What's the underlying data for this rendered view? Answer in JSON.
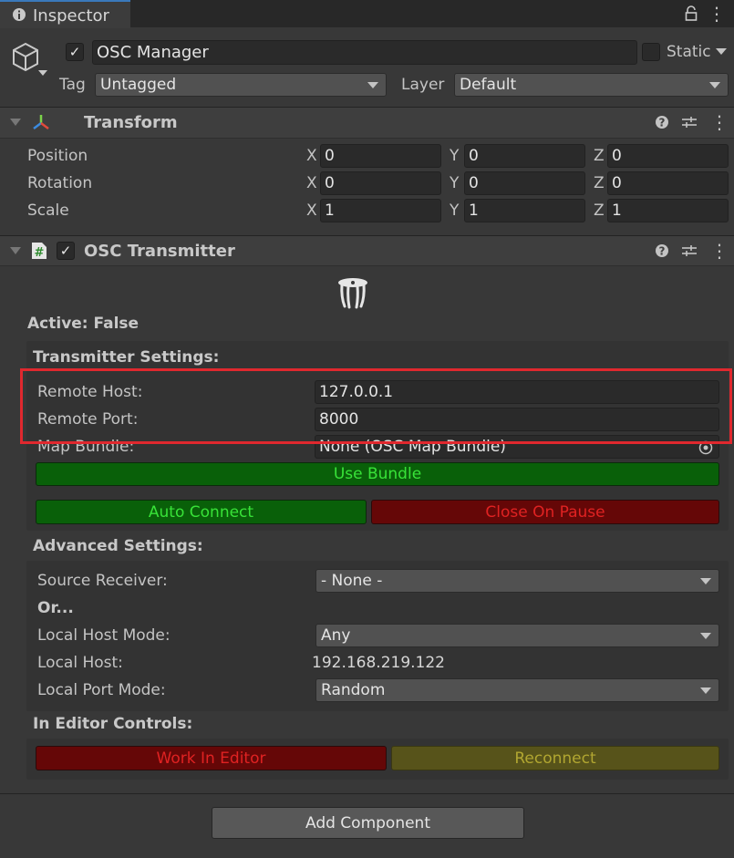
{
  "window": {
    "tab_label": "Inspector"
  },
  "header": {
    "object_name": "OSC Manager",
    "static_label": "Static",
    "tag_label": "Tag",
    "tag_value": "Untagged",
    "layer_label": "Layer",
    "layer_value": "Default"
  },
  "transform": {
    "title": "Transform",
    "rows": [
      {
        "label": "Position",
        "x": "0",
        "y": "0",
        "z": "0"
      },
      {
        "label": "Rotation",
        "x": "0",
        "y": "0",
        "z": "0"
      },
      {
        "label": "Scale",
        "x": "1",
        "y": "1",
        "z": "1"
      }
    ],
    "axes": {
      "x": "X",
      "y": "Y",
      "z": "Z"
    }
  },
  "osc": {
    "title": "OSC Transmitter",
    "active_text": "Active: False",
    "transmitter_settings": "Transmitter Settings:",
    "remote_host_label": "Remote Host:",
    "remote_host_value": "127.0.0.1",
    "remote_port_label": "Remote Port:",
    "remote_port_value": "8000",
    "map_bundle_label": "Map Bundle:",
    "map_bundle_value": "None (OSC Map Bundle)",
    "use_bundle": "Use Bundle",
    "auto_connect": "Auto Connect",
    "close_on_pause": "Close On Pause",
    "advanced_settings": "Advanced Settings:",
    "source_receiver_label": "Source Receiver:",
    "source_receiver_value": "- None -",
    "or_label": "Or...",
    "local_host_mode_label": "Local Host Mode:",
    "local_host_mode_value": "Any",
    "local_host_label": "Local Host:",
    "local_host_value": "192.168.219.122",
    "local_port_mode_label": "Local Port Mode:",
    "local_port_mode_value": "Random",
    "editor_controls": "In Editor Controls:",
    "work_in_editor": "Work In Editor",
    "reconnect": "Reconnect"
  },
  "footer": {
    "add_component": "Add Component"
  },
  "colors": {
    "accent_highlight": "#e0282e",
    "green_button": "#096009",
    "red_button": "#650707",
    "yellow_button": "#57531a"
  },
  "icons": [
    "info-icon",
    "lock-icon",
    "menu-icon",
    "cube-icon",
    "transform-axes-icon",
    "help-icon",
    "preset-icon",
    "kebab-icon",
    "script-icon",
    "osc-logo-icon",
    "object-picker-icon"
  ]
}
